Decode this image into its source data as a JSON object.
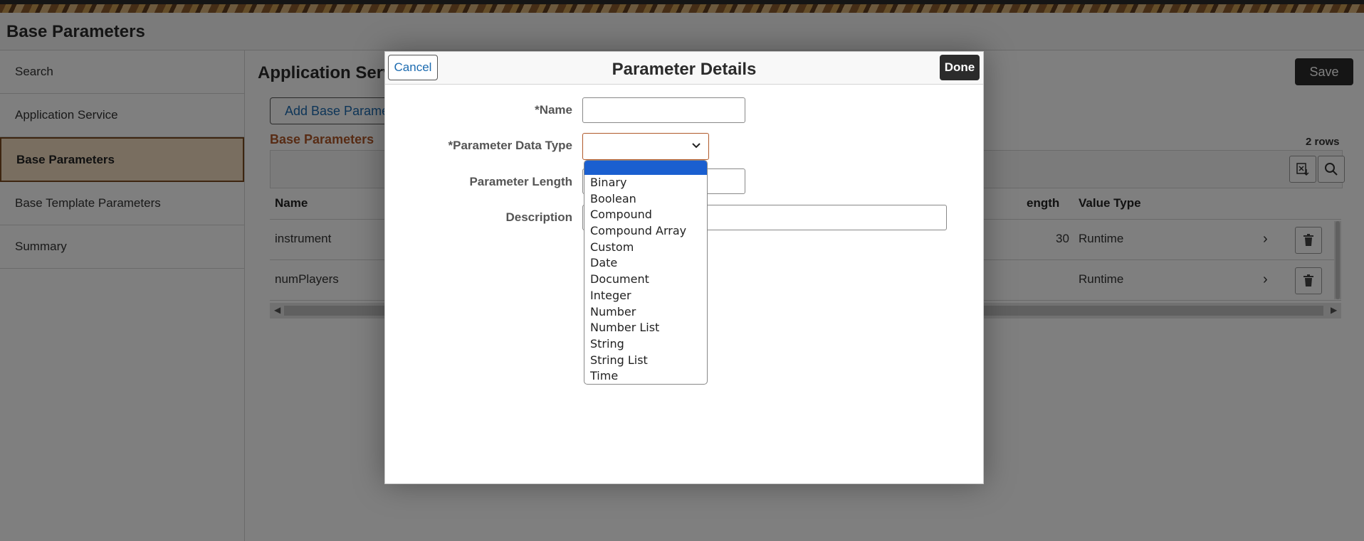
{
  "app": {
    "title": "Base Parameters"
  },
  "sidebar": {
    "items": [
      {
        "label": "Search"
      },
      {
        "label": "Application Service"
      },
      {
        "label": "Base Parameters"
      },
      {
        "label": "Base Template Parameters"
      },
      {
        "label": "Summary"
      }
    ]
  },
  "main": {
    "title": "Application Servi",
    "save_label": "Save",
    "add_label": "Add Base Paramete",
    "grid_title": "Base Parameters",
    "rows_count": "2 rows",
    "columns": {
      "name": "Name",
      "length": "ength",
      "value_type": "Value Type"
    },
    "rows": [
      {
        "name": "instrument",
        "length": "30",
        "value_type": "Runtime"
      },
      {
        "name": "numPlayers",
        "length": "",
        "value_type": "Runtime"
      }
    ]
  },
  "modal": {
    "title": "Parameter Details",
    "cancel_label": "Cancel",
    "done_label": "Done",
    "fields": {
      "name_label": "*Name",
      "name_value": "",
      "data_type_label": "*Parameter Data Type",
      "data_type_value": "",
      "length_label": "Parameter Length",
      "description_label": "Description"
    }
  },
  "dropdown": {
    "options": [
      "",
      "Binary",
      "Boolean",
      "Compound",
      "Compound Array",
      "Custom",
      "Date",
      "Document",
      "Integer",
      "Number",
      "Number List",
      "String",
      "String List",
      "Time"
    ],
    "selected_index": 0
  },
  "colors": {
    "accent_orange": "#b0592a",
    "active_nav_bg": "#f3dcc1",
    "link_blue": "#1c6bb0",
    "selected_option": "#1a5fd0",
    "dark_button": "#2b2b2b"
  },
  "icons": [
    "export-icon",
    "search-icon",
    "chevron-right-icon",
    "trash-icon",
    "chevron-down-icon",
    "scroll-left-icon",
    "scroll-right-icon"
  ]
}
